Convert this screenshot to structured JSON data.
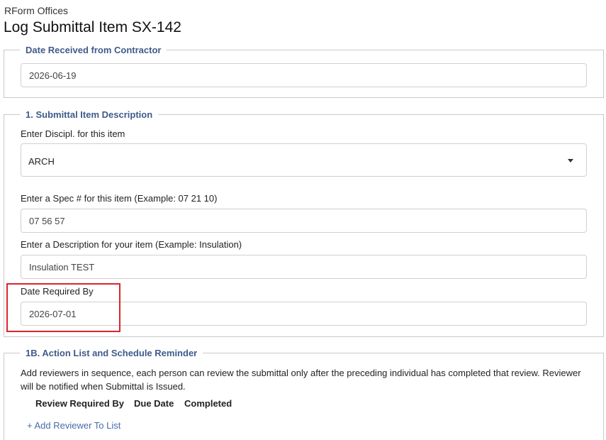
{
  "header": {
    "app_name": "RForm Offices",
    "title": "Log Submittal Item SX-142"
  },
  "date_received": {
    "legend": "Date Received from Contractor",
    "value": "2026-06-19"
  },
  "description_section": {
    "legend": "1. Submittal Item Description",
    "discipline_label": "Enter Discipl. for this item",
    "discipline_value": "ARCH",
    "spec_label": "Enter a Spec # for this item (Example: 07 21 10)",
    "spec_value": "07 56 57",
    "description_label": "Enter a Description for your item (Example: Insulation)",
    "description_value": "Insulation TEST",
    "date_required_label": "Date Required By",
    "date_required_value": "2026-07-01"
  },
  "action_section": {
    "legend": "1B. Action List and Schedule Reminder",
    "helper_text": "Add reviewers in sequence, each person can review the submittal only after the preceding individual has completed that review. Reviewer will be notified when Submittal is Issued.",
    "columns": [
      "Review Required By",
      "Due Date",
      "Completed"
    ],
    "add_link": "+ Add Reviewer To List"
  },
  "colors": {
    "legend": "#3f5b8a",
    "link": "#4a6aa8",
    "highlight": "#d9262c"
  },
  "icons": {
    "select_caret": "caret-down-icon"
  }
}
